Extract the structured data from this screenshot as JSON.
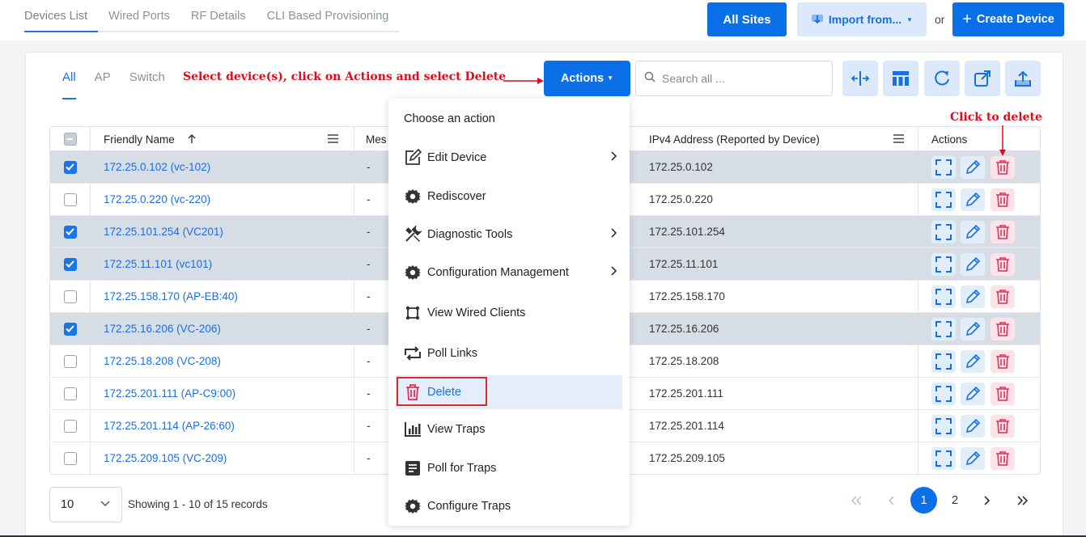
{
  "top_tabs": [
    "Devices List",
    "Wired Ports",
    "RF Details",
    "CLI Based Provisioning"
  ],
  "header": {
    "all_sites": "All Sites",
    "import": "Import from...",
    "or": "or",
    "create": "Create Device"
  },
  "filter_tabs": [
    "All",
    "AP",
    "Switch"
  ],
  "annotation_top": "Select device(s), click on Actions and select Delete",
  "annotation_right": "Click to delete",
  "actions_button": "Actions",
  "search": {
    "placeholder": "Search all ..."
  },
  "table": {
    "columns": {
      "friendly_name": "Friendly Name",
      "mesh": "Mes",
      "ipv4": "IPv4 Address (Reported by Device)",
      "actions": "Actions"
    },
    "rows": [
      {
        "name": "172.25.0.102 (vc-102)",
        "mesh": "-",
        "ip": "172.25.0.102",
        "checked": true
      },
      {
        "name": "172.25.0.220 (vc-220)",
        "mesh": "-",
        "ip": "172.25.0.220",
        "checked": false
      },
      {
        "name": "172.25.101.254 (VC201)",
        "mesh": "-",
        "ip": "172.25.101.254",
        "checked": true
      },
      {
        "name": "172.25.11.101 (vc101)",
        "mesh": "-",
        "ip": "172.25.11.101",
        "checked": true
      },
      {
        "name": "172.25.158.170 (AP-EB:40)",
        "mesh": "-",
        "ip": "172.25.158.170",
        "checked": false
      },
      {
        "name": "172.25.16.206 (VC-206)",
        "mesh": "-",
        "ip": "172.25.16.206",
        "checked": true
      },
      {
        "name": "172.25.18.208 (VC-208)",
        "mesh": "-",
        "ip": "172.25.18.208",
        "checked": false
      },
      {
        "name": "172.25.201.111 (AP-C9:00)",
        "mesh": "-",
        "ip": "172.25.201.111",
        "checked": false
      },
      {
        "name": "172.25.201.114 (AP-26:60)",
        "mesh": "-",
        "ip": "172.25.201.114",
        "checked": false
      },
      {
        "name": "172.25.209.105 (VC-209)",
        "mesh": "-",
        "ip": "172.25.209.105",
        "checked": false
      }
    ]
  },
  "menu": {
    "title": "Choose an action",
    "items": [
      {
        "label": "Edit Device",
        "icon": "edit-icon",
        "submenu": true
      },
      {
        "label": "Rediscover",
        "icon": "gear-icon",
        "submenu": false
      },
      {
        "label": "Diagnostic Tools",
        "icon": "tools-icon",
        "submenu": true
      },
      {
        "label": "Configuration Management",
        "icon": "gear-icon",
        "submenu": true
      },
      {
        "label": "View Wired Clients",
        "icon": "network-icon",
        "submenu": false
      },
      {
        "label": "Poll Links",
        "icon": "repeat-icon",
        "submenu": false
      },
      {
        "label": "Delete",
        "icon": "trash-icon",
        "submenu": false,
        "highlighted": true
      },
      {
        "label": "View Traps",
        "icon": "bar-chart-icon",
        "submenu": false
      },
      {
        "label": "Poll for Traps",
        "icon": "list-icon",
        "submenu": false
      },
      {
        "label": "Configure Traps",
        "icon": "gear-icon",
        "submenu": false
      }
    ]
  },
  "footer": {
    "page_size": "10",
    "showing": "Showing 1 - 10 of 15 records",
    "pages": [
      "1",
      "2"
    ],
    "current_page": "1"
  },
  "colors": {
    "primary": "#0b6fe8",
    "annotation_red": "#e00b1c",
    "selected_row": "#d7dde4",
    "delete_red": "#e0305a"
  }
}
